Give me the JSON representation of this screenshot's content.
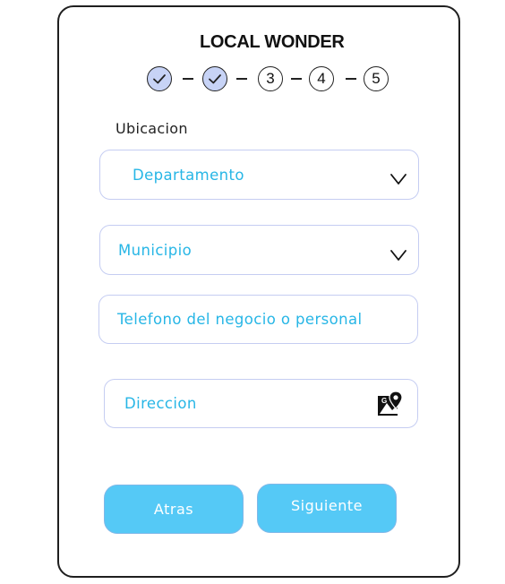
{
  "app": {
    "title": "LOCAL WONDER"
  },
  "stepper": {
    "steps": [
      {
        "label": "",
        "state": "done"
      },
      {
        "label": "",
        "state": "done"
      },
      {
        "label": "3",
        "state": "pending"
      },
      {
        "label": "4",
        "state": "pending"
      },
      {
        "label": "5",
        "state": "pending"
      }
    ],
    "done_color": "#c7d3f6"
  },
  "form": {
    "section_label": "Ubicacion",
    "departamento": {
      "placeholder": "Departamento",
      "icon": "chevron-down-icon"
    },
    "municipio": {
      "placeholder": "Municipio",
      "icon": "chevron-down-icon"
    },
    "telefono": {
      "placeholder": "Telefono del negocio o personal"
    },
    "direccion": {
      "placeholder": "Direccion",
      "icon": "google-maps-pin-icon"
    }
  },
  "actions": {
    "back_label": "Atras",
    "next_label": "Siguiente",
    "button_color": "#55c9f6"
  },
  "colors": {
    "field_text": "#27b6e6",
    "field_border": "#c5cdf2"
  }
}
